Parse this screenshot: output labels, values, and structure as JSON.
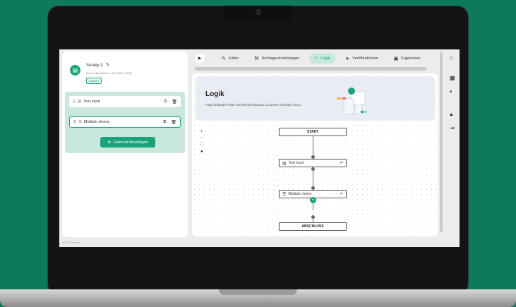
{
  "survey": {
    "title": "Survey 3",
    "updated": "Zuletzt aktualisiert: 21.6.2024, 08:58",
    "status_badge": "Entwurf",
    "avatar_glyph": "▤"
  },
  "elements": [
    {
      "label": "Text input",
      "type_glyph": "▤"
    },
    {
      "label": "Multiple choice",
      "type_glyph": "☰"
    }
  ],
  "add_element_label": "Element hinzufügen",
  "add_element_glyph": "⇆",
  "version": "v0.2.35 | beta",
  "toolbar": {
    "play_glyph": "▶",
    "tabs": [
      {
        "label": "Editor",
        "glyph": "✎"
      },
      {
        "label": "Umfrageeinstellungen",
        "glyph": "⚒"
      },
      {
        "label": "Logik",
        "glyph": "⑂"
      },
      {
        "label": "Veröffentlichen",
        "glyph": "➤"
      },
      {
        "label": "Ergebnisse",
        "glyph": "▣"
      }
    ]
  },
  "logic": {
    "title": "Logik",
    "description": "Füge bedingte Pfade und Wiederholungen zu deiner Umfrage hinzu."
  },
  "zoom": {
    "plus": "+",
    "minus": "−",
    "fit": "⛶",
    "center": "●"
  },
  "flow": {
    "start": "START",
    "end": "ABSCHLUSS",
    "nodes": [
      {
        "label": "Text input",
        "glyph": "▤"
      },
      {
        "label": "Multiple choice",
        "glyph": "☰"
      }
    ],
    "branch_glyph": "⇄",
    "plus_glyph": "+"
  },
  "sidebar_icons": {
    "home": "⌂",
    "layers": "▦",
    "theme": "◐",
    "account": "●",
    "logout": "⇥"
  },
  "colors": {
    "accent": "#1aa37a",
    "background": "#0e7a5c",
    "accent_light": "#c8e8dc"
  }
}
